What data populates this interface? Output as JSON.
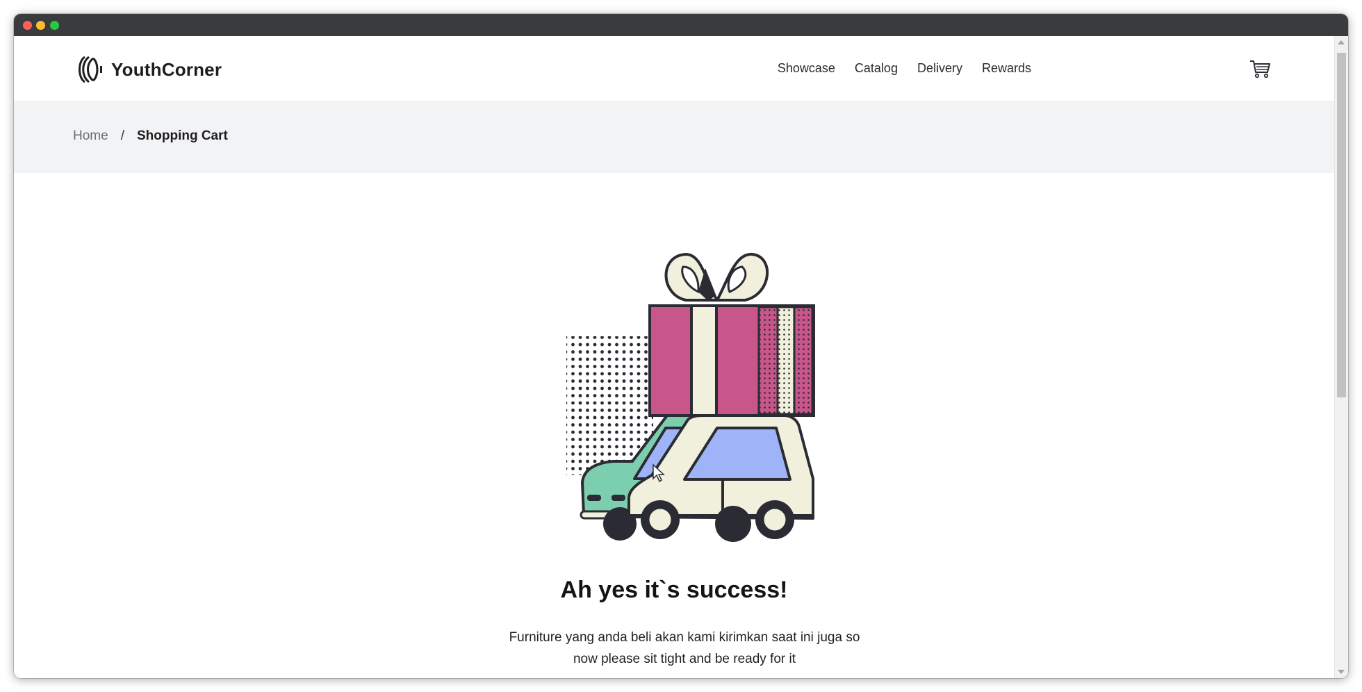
{
  "brand": {
    "name": "YouthCorner",
    "logo_icon": "brand-logo-icon"
  },
  "nav": {
    "items": [
      "Showcase",
      "Catalog",
      "Delivery",
      "Rewards"
    ],
    "cart_icon": "shopping-cart-icon"
  },
  "breadcrumb": {
    "home": "Home",
    "separator": "/",
    "current": "Shopping Cart"
  },
  "success": {
    "title": "Ah yes it`s success!",
    "description_line1": "Furniture yang anda beli akan kami kirimkan saat ini juga so",
    "description_line2": "now please sit tight and be ready for it",
    "illustration_icon": "gift-car-illustration"
  },
  "colors": {
    "gift_pink": "#c8568a",
    "cream": "#f0f0dc",
    "window_blue": "#9fb3f8",
    "car_green": "#7ccfae",
    "outline": "#2b2b33",
    "breadcrumb_bg": "#f2f3f5"
  }
}
